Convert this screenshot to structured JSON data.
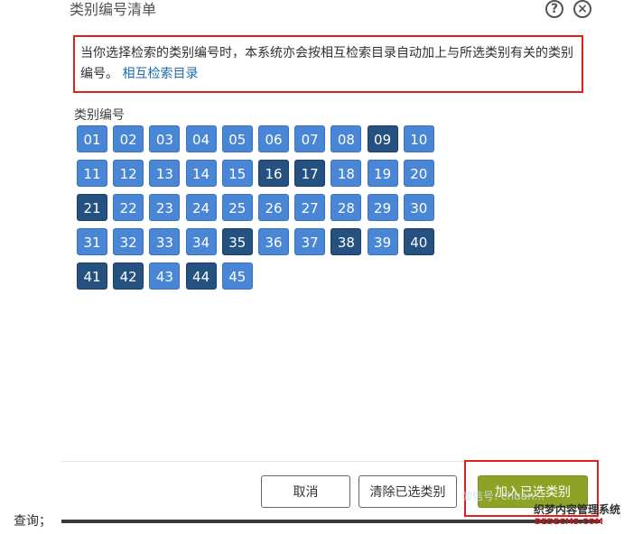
{
  "dialog": {
    "title": "类别编号清单",
    "help_icon_glyph": "?",
    "close_icon_glyph": "×",
    "notice_text": "当你选择检索的类别编号时，本系统亦会按相互检索目录自动加上与所选类别有关的类别编号。",
    "notice_link": "相互检索目录",
    "category_label": "类别编号",
    "categories": [
      {
        "code": "01",
        "selected": false
      },
      {
        "code": "02",
        "selected": false
      },
      {
        "code": "03",
        "selected": false
      },
      {
        "code": "04",
        "selected": false
      },
      {
        "code": "05",
        "selected": false
      },
      {
        "code": "06",
        "selected": false
      },
      {
        "code": "07",
        "selected": false
      },
      {
        "code": "08",
        "selected": false
      },
      {
        "code": "09",
        "selected": true
      },
      {
        "code": "10",
        "selected": false
      },
      {
        "code": "11",
        "selected": false
      },
      {
        "code": "12",
        "selected": false
      },
      {
        "code": "13",
        "selected": false
      },
      {
        "code": "14",
        "selected": false
      },
      {
        "code": "15",
        "selected": false
      },
      {
        "code": "16",
        "selected": true
      },
      {
        "code": "17",
        "selected": true
      },
      {
        "code": "18",
        "selected": false
      },
      {
        "code": "19",
        "selected": false
      },
      {
        "code": "20",
        "selected": false
      },
      {
        "code": "21",
        "selected": true
      },
      {
        "code": "22",
        "selected": false
      },
      {
        "code": "23",
        "selected": false
      },
      {
        "code": "24",
        "selected": false
      },
      {
        "code": "25",
        "selected": false
      },
      {
        "code": "26",
        "selected": false
      },
      {
        "code": "27",
        "selected": false
      },
      {
        "code": "28",
        "selected": false
      },
      {
        "code": "29",
        "selected": false
      },
      {
        "code": "30",
        "selected": false
      },
      {
        "code": "31",
        "selected": false
      },
      {
        "code": "32",
        "selected": false
      },
      {
        "code": "33",
        "selected": false
      },
      {
        "code": "34",
        "selected": false
      },
      {
        "code": "35",
        "selected": true
      },
      {
        "code": "36",
        "selected": false
      },
      {
        "code": "37",
        "selected": false
      },
      {
        "code": "38",
        "selected": true
      },
      {
        "code": "39",
        "selected": false
      },
      {
        "code": "40",
        "selected": true
      },
      {
        "code": "41",
        "selected": true
      },
      {
        "code": "42",
        "selected": true
      },
      {
        "code": "43",
        "selected": false
      },
      {
        "code": "44",
        "selected": true
      },
      {
        "code": "45",
        "selected": false
      }
    ],
    "buttons": {
      "cancel": "取消",
      "clear": "清除已选类别",
      "add": "加入已选类别"
    }
  },
  "page": {
    "query_label": "查询；"
  },
  "watermark": {
    "wechat": "微信号: chuan...",
    "site": "织梦内容管理系统",
    "domain": "DEDECMS.COM"
  },
  "colors": {
    "unselected": "#4a86d6",
    "selected": "#24517f",
    "highlight": "#e0201b",
    "add_button": "#8ea325",
    "link": "#1f6bb2"
  }
}
